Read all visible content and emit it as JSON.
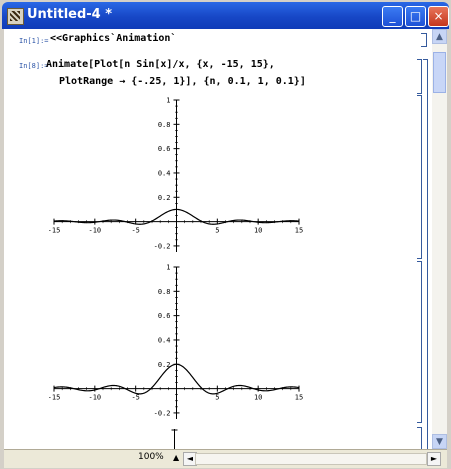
{
  "window": {
    "title": "Untitled-4 *",
    "controls": [
      "_",
      "□",
      "×"
    ]
  },
  "notebook": {
    "cell1": {
      "label": "In[1]:=",
      "code": "<<Graphics`Animation`"
    },
    "cell2": {
      "label": "In[8]:=",
      "line1": "Animate[Plot[n Sin[x]/x, {x, -15, 15},",
      "line2": "PlotRange → {-.25, 1}], {n, 0.1, 1, 0.1}]"
    },
    "plots": [
      {
        "n": 0.1,
        "yticks": [
          "1",
          "0.8",
          "0.6",
          "0.4",
          "0.2",
          "-0.2"
        ],
        "xticks": [
          "-15",
          "-10",
          "-5",
          "5",
          "10",
          "15"
        ]
      },
      {
        "n": 0.2,
        "yticks": [
          "1",
          "0.8",
          "0.6",
          "0.4",
          "0.2",
          "-0.2"
        ],
        "xticks": [
          "-15",
          "-10",
          "-5",
          "5",
          "10",
          "15"
        ]
      }
    ]
  },
  "statusbar": {
    "zoom": "100%",
    "zoom_arrow": "▲",
    "left_arrow": "◄",
    "right_arrow": "►"
  },
  "scrollbar": {
    "up": "▲",
    "down": "▼"
  },
  "chart_data": [
    {
      "type": "line",
      "function": "n Sin[x]/x",
      "n": 0.1,
      "xlim": [
        -15,
        15
      ],
      "ylim": [
        -0.25,
        1
      ],
      "xticks": [
        -15,
        -10,
        -5,
        5,
        10,
        15
      ],
      "yticks": [
        1,
        0.8,
        0.6,
        0.4,
        0.2,
        -0.2
      ]
    },
    {
      "type": "line",
      "function": "n Sin[x]/x",
      "n": 0.2,
      "xlim": [
        -15,
        15
      ],
      "ylim": [
        -0.25,
        1
      ],
      "xticks": [
        -15,
        -10,
        -5,
        5,
        10,
        15
      ],
      "yticks": [
        1,
        0.8,
        0.6,
        0.4,
        0.2,
        -0.2
      ]
    }
  ]
}
